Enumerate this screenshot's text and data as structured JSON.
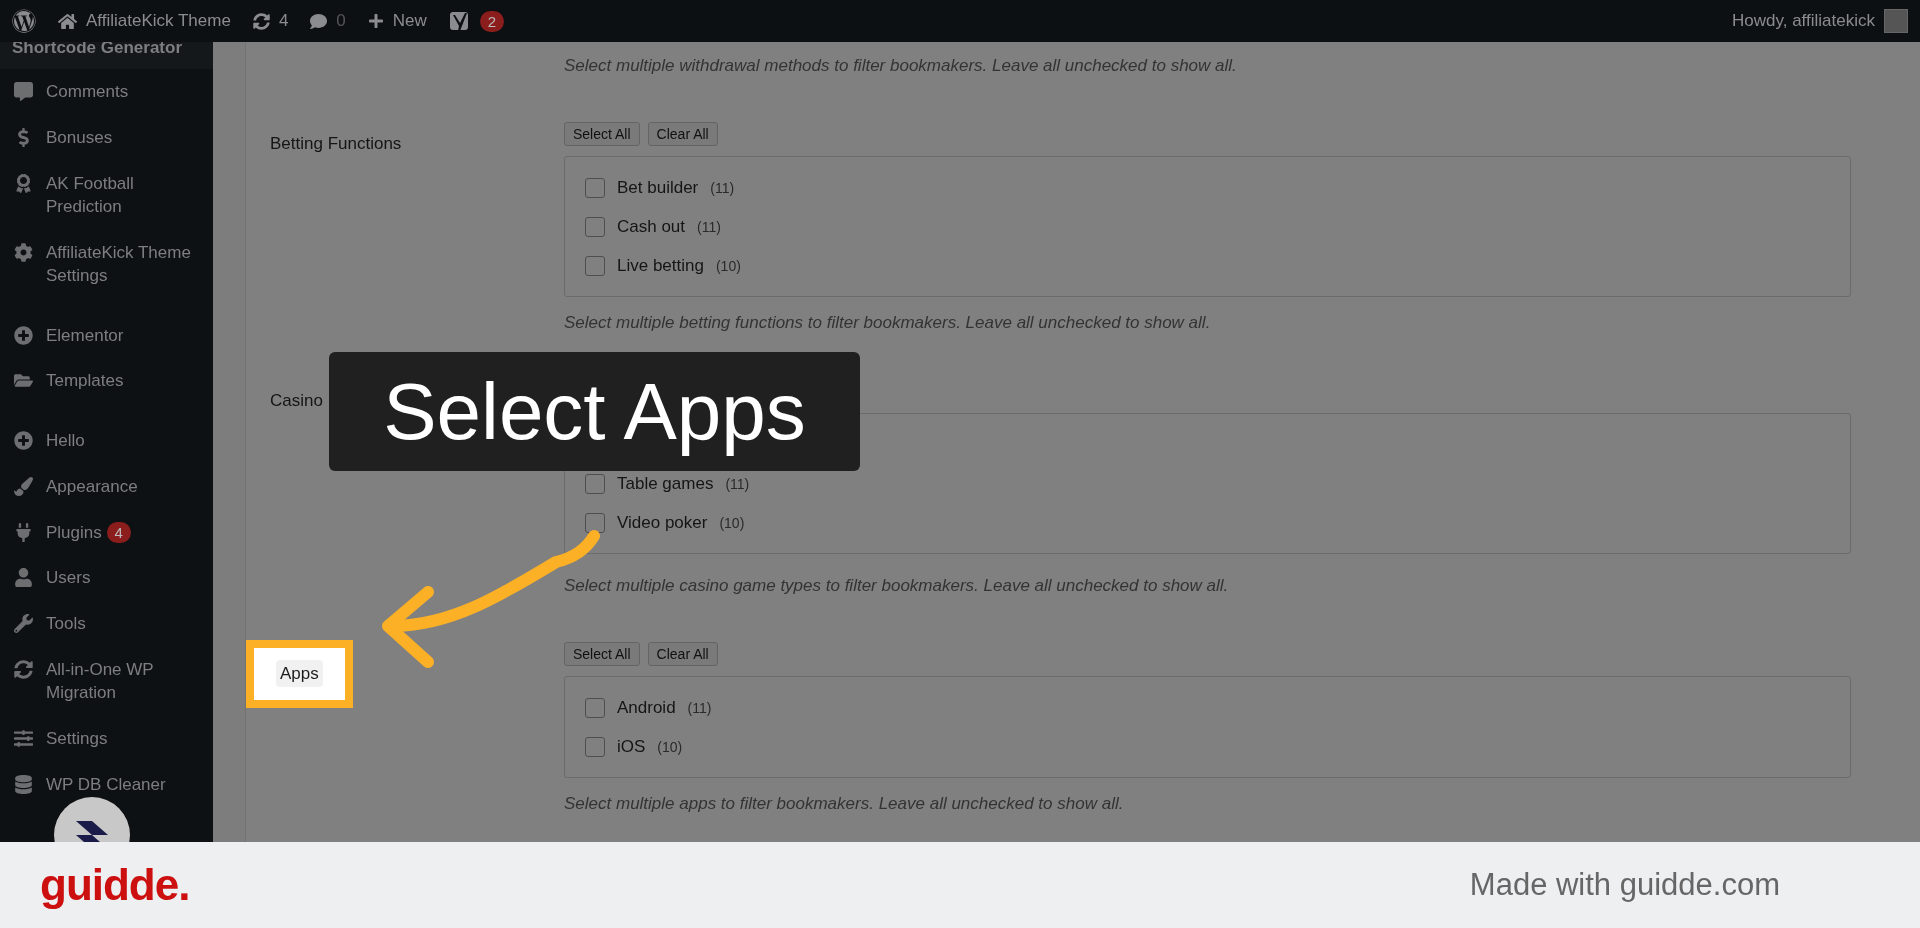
{
  "admin_bar": {
    "site_name": "AffiliateKick Theme",
    "updates": "4",
    "comments": "0",
    "new_label": "New",
    "seo_badge": "2",
    "greeting": "Howdy, affiliatekick"
  },
  "sidebar": {
    "groups": [
      {
        "items": [
          {
            "label": "Shortcode Generator",
            "selected": true
          },
          {
            "label": "Comments",
            "selected": false
          },
          {
            "label": "Bonuses",
            "selected": false
          },
          {
            "label": "AK Football Prediction",
            "selected": false
          },
          {
            "label": "AffiliateKick Theme Settings",
            "selected": false
          }
        ]
      },
      {
        "items": [
          {
            "label": "Elementor",
            "selected": false
          },
          {
            "label": "Templates",
            "selected": false
          }
        ]
      },
      {
        "items": [
          {
            "label": "Hello",
            "selected": false
          },
          {
            "label": "Appearance",
            "selected": false
          },
          {
            "label": "Plugins",
            "selected": false,
            "badge": "4"
          },
          {
            "label": "Users",
            "selected": false
          },
          {
            "label": "Tools",
            "selected": false
          },
          {
            "label": "All-in-One WP Migration",
            "selected": false
          },
          {
            "label": "Settings",
            "selected": false
          },
          {
            "label": "WP DB Cleaner",
            "selected": false
          }
        ]
      }
    ]
  },
  "intro_help": "Select multiple withdrawal methods to filter bookmakers. Leave all unchecked to show all.",
  "sections": [
    {
      "label": "Betting Functions",
      "highlighted": false,
      "select_all": "Select All",
      "clear_all": "Clear All",
      "options": [
        {
          "label": "Bet builder",
          "count": "(11)",
          "checked": false
        },
        {
          "label": "Cash out",
          "count": "(11)",
          "checked": false
        },
        {
          "label": "Live betting",
          "count": "(10)",
          "checked": false
        }
      ],
      "help": "Select multiple betting functions to filter bookmakers. Leave all unchecked to show all."
    },
    {
      "label": "Casino",
      "highlighted": false,
      "options": [
        {
          "label": "Table games",
          "count": "(11)",
          "checked": false
        },
        {
          "label": "Video poker",
          "count": "(10)",
          "checked": false
        }
      ],
      "help": "Select multiple casino game types to filter bookmakers. Leave all unchecked to show all."
    },
    {
      "label": "Apps",
      "highlighted": true,
      "select_all": "Select All",
      "clear_all": "Clear All",
      "options": [
        {
          "label": "Android",
          "count": "(11)",
          "checked": false
        },
        {
          "label": "iOS",
          "count": "(10)",
          "checked": false
        }
      ],
      "help": "Select multiple apps to filter bookmakers. Leave all unchecked to show all."
    }
  ],
  "callout": {
    "text": "Select Apps"
  },
  "footer": {
    "logo": "guidde.",
    "credit": "Made with guidde.com"
  }
}
